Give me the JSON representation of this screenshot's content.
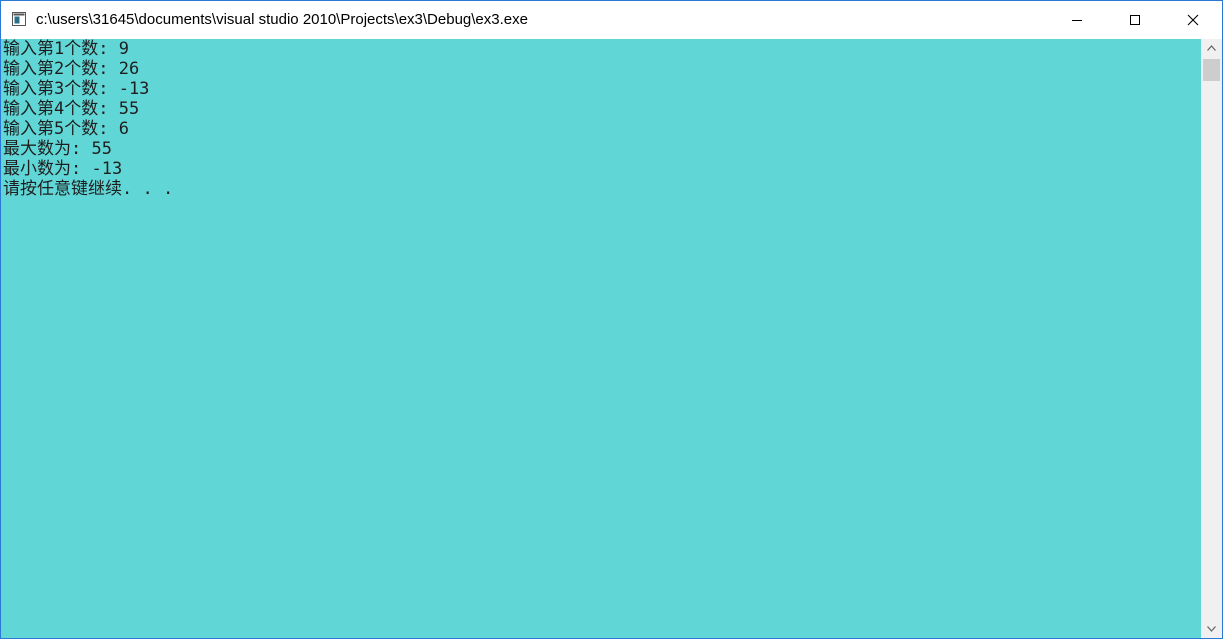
{
  "window": {
    "title": "c:\\users\\31645\\documents\\visual studio 2010\\Projects\\ex3\\Debug\\ex3.exe",
    "icon": "console-app-icon",
    "controls": {
      "minimize_icon": "minimize-icon",
      "maximize_icon": "maximize-icon",
      "close_icon": "close-icon"
    }
  },
  "console": {
    "background_color": "#61d6d6",
    "text_color": "#1f1f1f",
    "lines": [
      "输入第1个数: 9",
      "输入第2个数: 26",
      "输入第3个数: -13",
      "输入第4个数: 55",
      "输入第5个数: 6",
      "最大数为: 55",
      "最小数为: -13",
      "请按任意键继续. . ."
    ]
  },
  "scrollbar": {
    "up_icon": "scroll-up-arrow-icon",
    "down_icon": "scroll-down-arrow-icon"
  }
}
